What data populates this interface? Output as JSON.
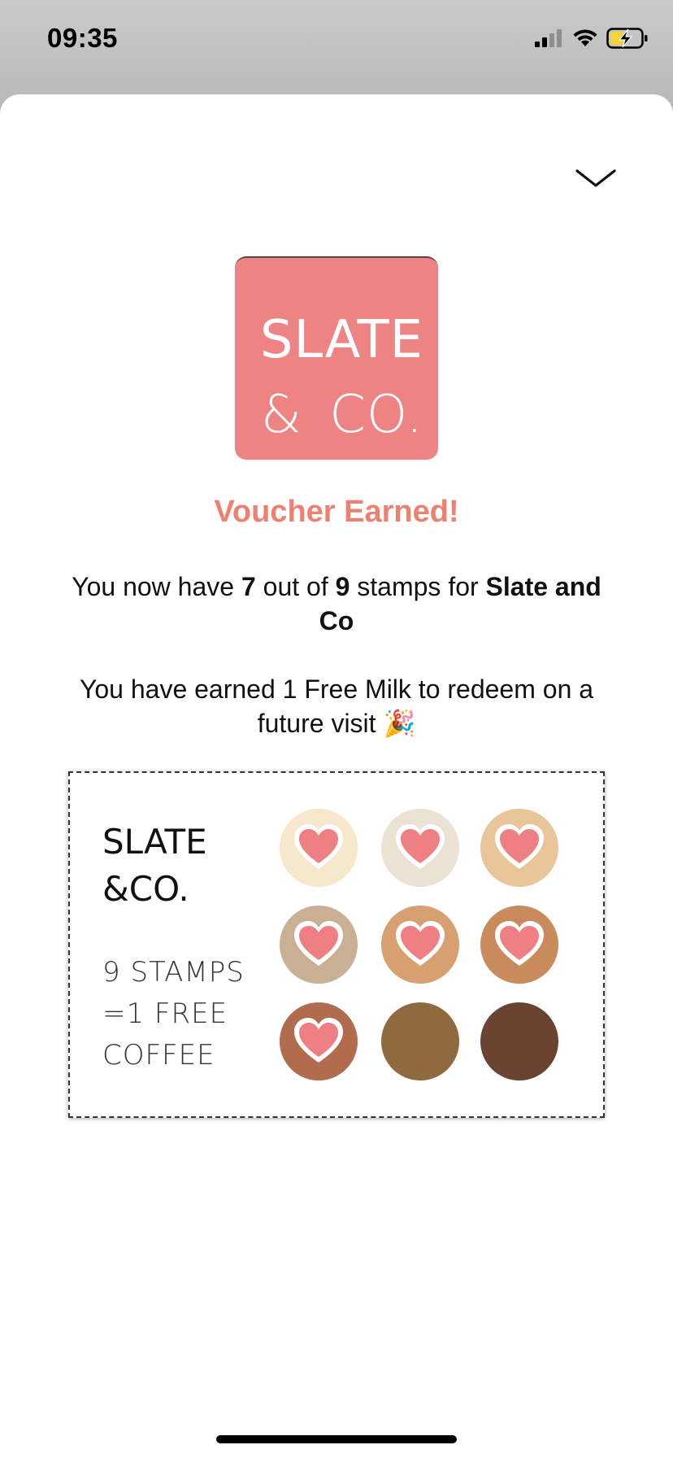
{
  "status_bar": {
    "time": "09:35",
    "icons": [
      "signal-icon",
      "wifi-icon",
      "battery-charging-icon"
    ]
  },
  "sheet": {
    "close_icon": "chevron-down-icon",
    "logo": {
      "line1": "SLATE",
      "line2": "& CO.",
      "background_color": "#ee8383"
    },
    "headline": "Voucher Earned!",
    "headline_color": "#ee8070",
    "stamp_message": {
      "prefix": "You now have ",
      "current": "7",
      "middle1": " out of ",
      "total": "9",
      "middle2": " stamps for ",
      "business": "Slate and Co"
    },
    "reward_message": {
      "text": "You have earned 1 Free Milk to redeem on a future visit",
      "emoji": "🎉"
    },
    "card": {
      "brand_line1": "SLATE",
      "brand_line2": "&CO.",
      "rule_line1": "9 STAMPS",
      "rule_line2": "=1 FREE",
      "rule_line3": "COFFEE",
      "stamps": [
        {
          "color": "#f5e8cb",
          "stamped": true
        },
        {
          "color": "#ebe2d4",
          "stamped": true
        },
        {
          "color": "#e8c699",
          "stamped": true
        },
        {
          "color": "#c9b095",
          "stamped": true
        },
        {
          "color": "#d6a070",
          "stamped": true
        },
        {
          "color": "#c98a5c",
          "stamped": true
        },
        {
          "color": "#b06c4c",
          "stamped": true
        },
        {
          "color": "#8e6a3e",
          "stamped": false
        },
        {
          "color": "#6b4431",
          "stamped": false
        }
      ],
      "stamps_collected": 7,
      "stamps_total": 9
    }
  }
}
